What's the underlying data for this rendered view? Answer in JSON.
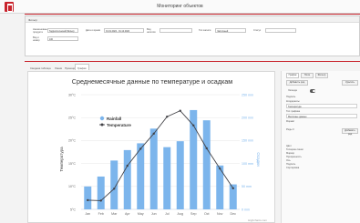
{
  "window": {
    "title": "Мониторинг объектов"
  },
  "filter": {
    "header": "Фильтр",
    "fields": [
      {
        "label": "Наименование продукта",
        "value": "Гидрологический Фильтр"
      },
      {
        "label": "Дата и время",
        "value": "01.01.2024 - 31.12.2024"
      },
      {
        "label": "Вид налогов",
        "value": ""
      },
      {
        "label": "Тип записи",
        "value": "Частичный"
      },
      {
        "label": "Статус",
        "value": ""
      },
      {
        "label": "Вид и номер",
        "value": "100"
      }
    ]
  },
  "tabs": [
    "Сводная таблица",
    "Линия",
    "Проекция",
    "График"
  ],
  "active_tab_index": 3,
  "right_panel": {
    "top_buttons": [
      "График",
      "Поля",
      "Фильтр"
    ],
    "buttons": [
      "Добавить ряд",
      "Удалить"
    ],
    "toggle_label": "Легенда",
    "labels": [
      "Подпись",
      "Координаты",
      "Тип графика",
      "Формат"
    ],
    "field_values": [
      "Температура",
      "Месячные данные"
    ],
    "section_label": "Ряды 3",
    "bottom_labels": [
      "Цвет",
      "Толщина линии",
      "Маркер",
      "Прозрачность",
      "Ось",
      "Подпись",
      "Сортировка"
    ]
  },
  "chart_data": {
    "type": "bar",
    "title": "Среднемесячные данные по температуре и осадкам",
    "categories": [
      "Jan",
      "Feb",
      "Mar",
      "Apr",
      "May",
      "Jun",
      "Jul",
      "Aug",
      "Sep",
      "Oct",
      "Nov",
      "Dec"
    ],
    "series": [
      {
        "name": "Rainfall",
        "type": "bar",
        "axis": "right",
        "color": "#7cb5ec",
        "values": [
          49.9,
          71.5,
          106.4,
          129.2,
          144.0,
          176.0,
          135.6,
          148.5,
          216.4,
          194.1,
          95.6,
          54.4
        ]
      },
      {
        "name": "Temperature",
        "type": "line",
        "axis": "left",
        "color": "#434348",
        "values": [
          7.0,
          6.9,
          9.5,
          14.5,
          18.2,
          21.5,
          25.2,
          26.5,
          23.3,
          18.3,
          13.9,
          9.6
        ]
      }
    ],
    "left_axis": {
      "label": "Температура",
      "ticks": [
        "5°C",
        "10°C",
        "15°C",
        "20°C",
        "25°C",
        "30°C"
      ],
      "ylim": [
        5,
        30
      ]
    },
    "right_axis": {
      "label": "Осадки",
      "ticks": [
        "0 mm",
        "50 mm",
        "100 mm",
        "150 mm",
        "200 mm",
        "250 mm"
      ],
      "ylim": [
        0,
        250
      ]
    },
    "legend_position": "top-left",
    "credits": "Highcharts.com",
    "grid": true
  }
}
